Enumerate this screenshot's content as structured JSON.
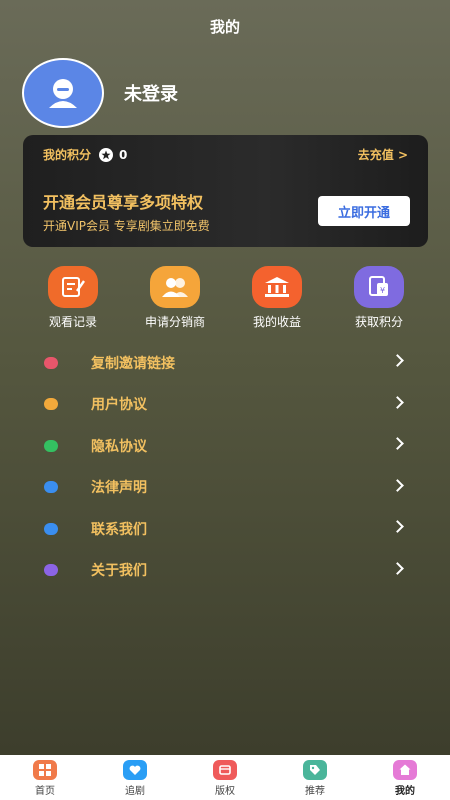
{
  "header": {
    "title": "我的"
  },
  "profile": {
    "username": "未登录"
  },
  "vip_card": {
    "points_label": "我的积分",
    "points_value": "0",
    "recharge_label": "去充值 >",
    "title": "开通会员尊享多项特权",
    "subtitle": "开通VIP会员 专享剧集立即免费",
    "button_label": "立即开通"
  },
  "quick_actions": [
    {
      "label": "观看记录",
      "icon": "edit-note-icon",
      "color": "#f06b2a"
    },
    {
      "label": "申请分销商",
      "icon": "users-icon",
      "color": "#f5a53a"
    },
    {
      "label": "我的收益",
      "icon": "bank-icon",
      "color": "#f4622e"
    },
    {
      "label": "获取积分",
      "icon": "coupon-icon",
      "color": "#7f6be0"
    }
  ],
  "menu": [
    {
      "label": "复制邀请链接",
      "icon": "link-icon",
      "color": "#e8566b"
    },
    {
      "label": "用户协议",
      "icon": "document-icon",
      "color": "#f2a93b"
    },
    {
      "label": "隐私协议",
      "icon": "shield-icon",
      "color": "#34c061"
    },
    {
      "label": "法律声明",
      "icon": "gavel-icon",
      "color": "#3a8ef0"
    },
    {
      "label": "联系我们",
      "icon": "phone-icon",
      "color": "#3a8ef0"
    },
    {
      "label": "关于我们",
      "icon": "info-icon",
      "color": "#8c64e6"
    }
  ],
  "tabbar": [
    {
      "label": "首页",
      "icon": "home-grid-icon",
      "color": "#f07a4a"
    },
    {
      "label": "追剧",
      "icon": "heart-icon",
      "color": "#2a9ef5"
    },
    {
      "label": "版权",
      "icon": "copyright-icon",
      "color": "#ef5a5a"
    },
    {
      "label": "推荐",
      "icon": "tag-icon",
      "color": "#4ab59a"
    },
    {
      "label": "我的",
      "icon": "home-icon",
      "color": "#e57ad6",
      "active": true
    }
  ]
}
